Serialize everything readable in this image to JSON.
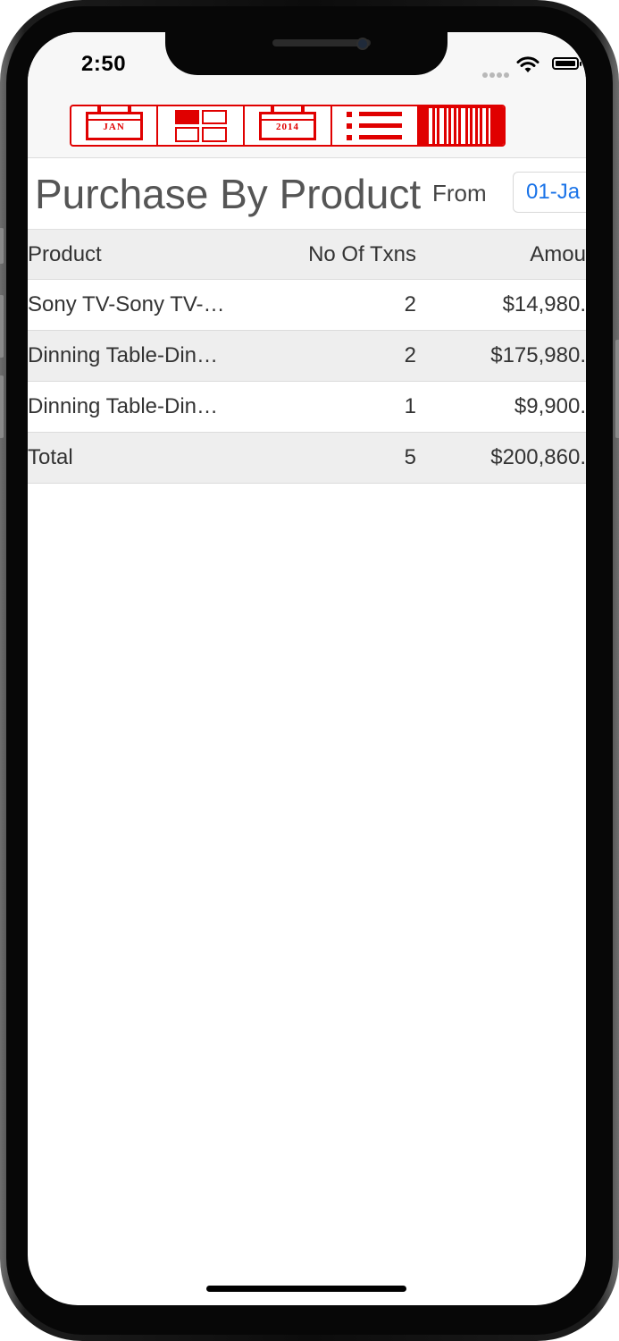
{
  "status_bar": {
    "time": "2:50"
  },
  "toolbar": {
    "segments": [
      {
        "id": "month",
        "icon": "calendar-month-icon",
        "label": "JAN"
      },
      {
        "id": "dashboard",
        "icon": "grid-icon"
      },
      {
        "id": "year",
        "icon": "calendar-year-icon",
        "label": "2014"
      },
      {
        "id": "list",
        "icon": "list-icon"
      },
      {
        "id": "barcode",
        "icon": "barcode-icon",
        "active": true
      }
    ],
    "accent_color": "#e00000"
  },
  "report": {
    "title": "Purchase By Product",
    "from_label": "From",
    "from_date": "01-Ja"
  },
  "table": {
    "headers": {
      "product": "Product",
      "txns": "No Of Txns",
      "amount": "Amou"
    },
    "rows": [
      {
        "product": "Sony TV-Sony TV-…",
        "txns": "2",
        "amount": "$14,980."
      },
      {
        "product": "Dinning Table-Din…",
        "txns": "2",
        "amount": "$175,980."
      },
      {
        "product": "Dinning Table-Din…",
        "txns": "1",
        "amount": "$9,900."
      }
    ],
    "total": {
      "label": "Total",
      "txns": "5",
      "amount": "$200,860."
    }
  },
  "colors": {
    "link": "#1a73e8",
    "title_text": "#555555"
  }
}
